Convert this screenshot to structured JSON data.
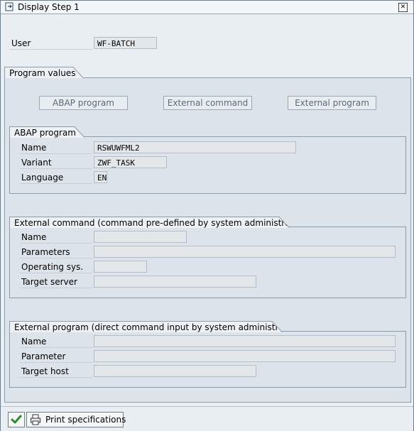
{
  "window": {
    "title": "Display Step  1"
  },
  "user": {
    "label": "User",
    "value": "WF-BATCH"
  },
  "program_values": {
    "title": "Program values",
    "buttons": [
      "ABAP program",
      "External command",
      "External program"
    ]
  },
  "abap_program": {
    "title": "ABAP program",
    "fields": [
      {
        "label": "Name",
        "value": "RSWUWFML2"
      },
      {
        "label": "Variant",
        "value": "ZWF_TASK"
      },
      {
        "label": "Language",
        "value": "EN"
      }
    ]
  },
  "external_command": {
    "title": "External command (command pre-defined by system administrator)",
    "fields": [
      {
        "label": "Name",
        "value": ""
      },
      {
        "label": "Parameters",
        "value": ""
      },
      {
        "label": "Operating sys.",
        "value": ""
      },
      {
        "label": "Target server",
        "value": ""
      }
    ]
  },
  "external_program": {
    "title": "External program (direct command input by system administrator)",
    "fields": [
      {
        "label": "Name",
        "value": ""
      },
      {
        "label": "Parameter",
        "value": ""
      },
      {
        "label": "Target host",
        "value": ""
      }
    ]
  },
  "footer": {
    "print_label": "Print specifications"
  },
  "icons": {
    "window": "display-document-icon",
    "close": "close-icon",
    "confirm": "check-icon",
    "print": "printer-icon"
  },
  "colors": {
    "confirm_green": "#2e8b2e"
  }
}
